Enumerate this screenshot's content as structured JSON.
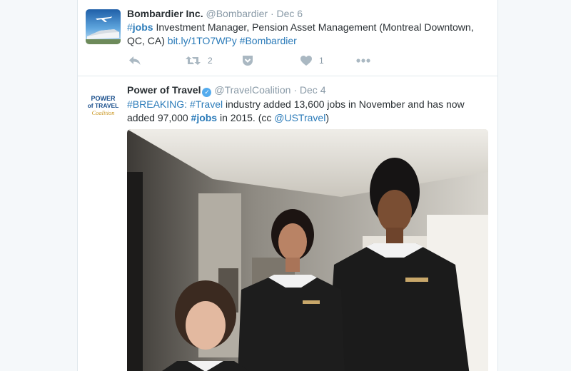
{
  "tweets": [
    {
      "fullname": "Bombardier Inc.",
      "username": "@Bombardier",
      "separator": "·",
      "time": "Dec 6",
      "text": {
        "hashtag1": "#jobs",
        "body": " Investment Manager, Pension Asset Management (Montreal Downtown, QC, CA) ",
        "link": "bit.ly/1TO7WPy",
        "space": " ",
        "hashtag2": "#Bombardier"
      },
      "actions": {
        "reply_icon": "reply-icon",
        "retweet_icon": "retweet-icon",
        "retweet_count": "2",
        "pocket_icon": "save-icon",
        "like_icon": "heart-icon",
        "like_count": "1",
        "more_icon": "more-icon"
      },
      "avatar_icon": "bombardier-plane-train-logo"
    },
    {
      "fullname": "Power of Travel",
      "username": "@TravelCoalition",
      "separator": "·",
      "time": "Dec 4",
      "verified": true,
      "text": {
        "hashtag1": "#BREAKING:",
        "space1": " ",
        "hashtag2": "#Travel",
        "body1": " industry added 13,600 jobs in November and has now added 97,000 ",
        "hashtag3": "#jobs",
        "body2": " in 2015. (cc ",
        "mention": "@USTravel",
        "body3": ")"
      },
      "avatar": {
        "line1": "POWER",
        "line2": "of TRAVEL",
        "line3": "Coalition"
      },
      "media_icon": "hotel-staff-photo"
    }
  ],
  "colors": {
    "link": "#2b7bb9",
    "secondary_text": "#8899a6",
    "action_icon": "#aab8c2",
    "verified": "#55acee"
  }
}
